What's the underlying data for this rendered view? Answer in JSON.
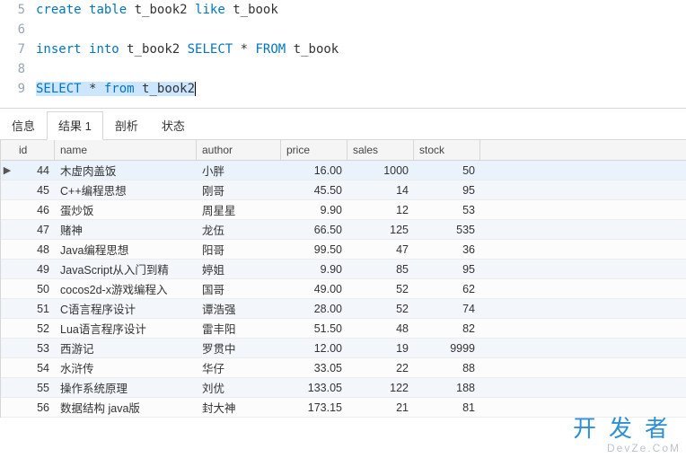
{
  "editor": {
    "lines": [
      {
        "num": 5,
        "tokens": [
          {
            "t": "create",
            "c": "kw-blue"
          },
          {
            "t": " "
          },
          {
            "t": "table",
            "c": "kw-blue"
          },
          {
            "t": " "
          },
          {
            "t": "t_book2",
            "c": "ident"
          },
          {
            "t": " "
          },
          {
            "t": "like",
            "c": "kw-blue"
          },
          {
            "t": " "
          },
          {
            "t": "t_book",
            "c": "ident"
          }
        ]
      },
      {
        "num": 6,
        "tokens": []
      },
      {
        "num": 7,
        "tokens": [
          {
            "t": "insert",
            "c": "kw-blue"
          },
          {
            "t": " "
          },
          {
            "t": "into",
            "c": "kw-blue"
          },
          {
            "t": " "
          },
          {
            "t": "t_book2",
            "c": "ident"
          },
          {
            "t": " "
          },
          {
            "t": "SELECT",
            "c": "kw-blue"
          },
          {
            "t": " * "
          },
          {
            "t": "FROM",
            "c": "kw-blue"
          },
          {
            "t": " "
          },
          {
            "t": "t_book",
            "c": "ident"
          }
        ]
      },
      {
        "num": 8,
        "tokens": []
      },
      {
        "num": 9,
        "selected": true,
        "tokens": [
          {
            "t": "SELECT",
            "c": "kw-blue"
          },
          {
            "t": " * "
          },
          {
            "t": "from",
            "c": "kw-blue"
          },
          {
            "t": " "
          },
          {
            "t": "t_book2",
            "c": "ident"
          }
        ]
      }
    ]
  },
  "tabs": [
    "信息",
    "结果 1",
    "剖析",
    "状态"
  ],
  "active_tab": 1,
  "columns": [
    "id",
    "name",
    "author",
    "price",
    "sales",
    "stock"
  ],
  "rows": [
    {
      "id": 44,
      "name": "木虚肉盖饭",
      "author": "小胖",
      "price": "16.00",
      "sales": 1000,
      "stock": 50,
      "active": true
    },
    {
      "id": 45,
      "name": "C++编程思想",
      "author": "刚哥",
      "price": "45.50",
      "sales": 14,
      "stock": 95
    },
    {
      "id": 46,
      "name": "蛋炒饭",
      "author": "周星星",
      "price": "9.90",
      "sales": 12,
      "stock": 53
    },
    {
      "id": 47,
      "name": "赌神",
      "author": "龙伍",
      "price": "66.50",
      "sales": 125,
      "stock": 535
    },
    {
      "id": 48,
      "name": "Java编程思想",
      "author": "阳哥",
      "price": "99.50",
      "sales": 47,
      "stock": 36
    },
    {
      "id": 49,
      "name": "JavaScript从入门到精",
      "author": "婷姐",
      "price": "9.90",
      "sales": 85,
      "stock": 95
    },
    {
      "id": 50,
      "name": "cocos2d-x游戏编程入",
      "author": "国哥",
      "price": "49.00",
      "sales": 52,
      "stock": 62
    },
    {
      "id": 51,
      "name": "C语言程序设计",
      "author": "谭浩强",
      "price": "28.00",
      "sales": 52,
      "stock": 74
    },
    {
      "id": 52,
      "name": "Lua语言程序设计",
      "author": "雷丰阳",
      "price": "51.50",
      "sales": 48,
      "stock": 82
    },
    {
      "id": 53,
      "name": "西游记",
      "author": "罗贯中",
      "price": "12.00",
      "sales": 19,
      "stock": 9999
    },
    {
      "id": 54,
      "name": "水浒传",
      "author": "华仔",
      "price": "33.05",
      "sales": 22,
      "stock": 88
    },
    {
      "id": 55,
      "name": "操作系统原理",
      "author": "刘优",
      "price": "133.05",
      "sales": 122,
      "stock": 188
    },
    {
      "id": 56,
      "name": "数据结构 java版",
      "author": "封大神",
      "price": "173.15",
      "sales": 21,
      "stock": 81
    }
  ],
  "watermark": {
    "top": "开发者",
    "bottom": "DevZe.CoM"
  }
}
